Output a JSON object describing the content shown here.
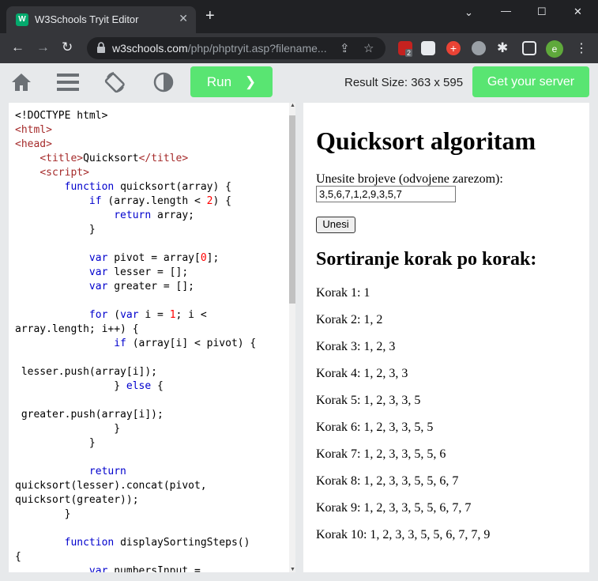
{
  "browser": {
    "tab_title": "W3Schools Tryit Editor",
    "tab_favicon": "W",
    "url_domain": "w3schools.com",
    "url_path": "/php/phptryit.asp?filename...",
    "extension_badge": "2",
    "profile_initial": "e"
  },
  "toolbar": {
    "run_label": "Run",
    "result_size": "Result Size: 363 x 595",
    "server_label": "Get your server"
  },
  "result": {
    "heading": "Quicksort algoritam",
    "input_label": "Unesite brojeve (odvojene zarezom):",
    "input_value": "3,5,6,7,1,2,9,3,5,7",
    "submit_label": "Unesi",
    "steps_heading": "Sortiranje korak po korak:",
    "steps": [
      "Korak 1: 1",
      "Korak 2: 1, 2",
      "Korak 3: 1, 2, 3",
      "Korak 4: 1, 2, 3, 3",
      "Korak 5: 1, 2, 3, 3, 5",
      "Korak 6: 1, 2, 3, 3, 5, 5",
      "Korak 7: 1, 2, 3, 3, 5, 5, 6",
      "Korak 8: 1, 2, 3, 3, 5, 5, 6, 7",
      "Korak 9: 1, 2, 3, 3, 5, 5, 6, 7, 7",
      "Korak 10: 1, 2, 3, 3, 5, 5, 6, 7, 7, 9"
    ]
  },
  "code": {
    "lines": [
      [
        [
          "",
          "<!DOCTYPE html>"
        ]
      ],
      [
        [
          "tag",
          "<html>"
        ]
      ],
      [
        [
          "tag",
          "<head>"
        ]
      ],
      [
        [
          "",
          "    "
        ],
        [
          "tag",
          "<title>"
        ],
        [
          "",
          "Quicksort"
        ],
        [
          "tag",
          "</title>"
        ]
      ],
      [
        [
          "",
          "    "
        ],
        [
          "tag",
          "<script>"
        ]
      ],
      [
        [
          "",
          "        "
        ],
        [
          "kw",
          "function"
        ],
        [
          "",
          " quicksort(array) {"
        ]
      ],
      [
        [
          "",
          "            "
        ],
        [
          "kw",
          "if"
        ],
        [
          "",
          " (array.length < "
        ],
        [
          "num",
          "2"
        ],
        [
          "",
          ") {"
        ]
      ],
      [
        [
          "",
          "                "
        ],
        [
          "kw",
          "return"
        ],
        [
          "",
          " array;"
        ]
      ],
      [
        [
          "",
          "            }"
        ]
      ],
      [
        [
          "",
          ""
        ]
      ],
      [
        [
          "",
          "            "
        ],
        [
          "kw",
          "var"
        ],
        [
          "",
          " pivot = array["
        ],
        [
          "num",
          "0"
        ],
        [
          "",
          "];"
        ]
      ],
      [
        [
          "",
          "            "
        ],
        [
          "kw",
          "var"
        ],
        [
          "",
          " lesser = [];"
        ]
      ],
      [
        [
          "",
          "            "
        ],
        [
          "kw",
          "var"
        ],
        [
          "",
          " greater = [];"
        ]
      ],
      [
        [
          "",
          ""
        ]
      ],
      [
        [
          "",
          "            "
        ],
        [
          "kw",
          "for"
        ],
        [
          "",
          " ("
        ],
        [
          "kw",
          "var"
        ],
        [
          "",
          " i = "
        ],
        [
          "num",
          "1"
        ],
        [
          "",
          "; i <"
        ]
      ],
      [
        [
          "",
          "array.length; i++) {"
        ]
      ],
      [
        [
          "",
          "                "
        ],
        [
          "kw",
          "if"
        ],
        [
          "",
          " (array[i] < pivot) {"
        ]
      ],
      [
        [
          "",
          ""
        ]
      ],
      [
        [
          "",
          " lesser.push(array[i]);"
        ]
      ],
      [
        [
          "",
          "                } "
        ],
        [
          "kw",
          "else"
        ],
        [
          "",
          " {"
        ]
      ],
      [
        [
          "",
          ""
        ]
      ],
      [
        [
          "",
          " greater.push(array[i]);"
        ]
      ],
      [
        [
          "",
          "                }"
        ]
      ],
      [
        [
          "",
          "            }"
        ]
      ],
      [
        [
          "",
          ""
        ]
      ],
      [
        [
          "",
          "            "
        ],
        [
          "kw",
          "return"
        ]
      ],
      [
        [
          "",
          "quicksort(lesser).concat(pivot,"
        ]
      ],
      [
        [
          "",
          "quicksort(greater));"
        ]
      ],
      [
        [
          "",
          "        }"
        ]
      ],
      [
        [
          "",
          ""
        ]
      ],
      [
        [
          "",
          "        "
        ],
        [
          "kw",
          "function"
        ],
        [
          "",
          " displaySortingSteps()"
        ]
      ],
      [
        [
          "",
          "{"
        ]
      ],
      [
        [
          "",
          "            "
        ],
        [
          "kw",
          "var"
        ],
        [
          "",
          " numbersInput ="
        ]
      ]
    ]
  }
}
